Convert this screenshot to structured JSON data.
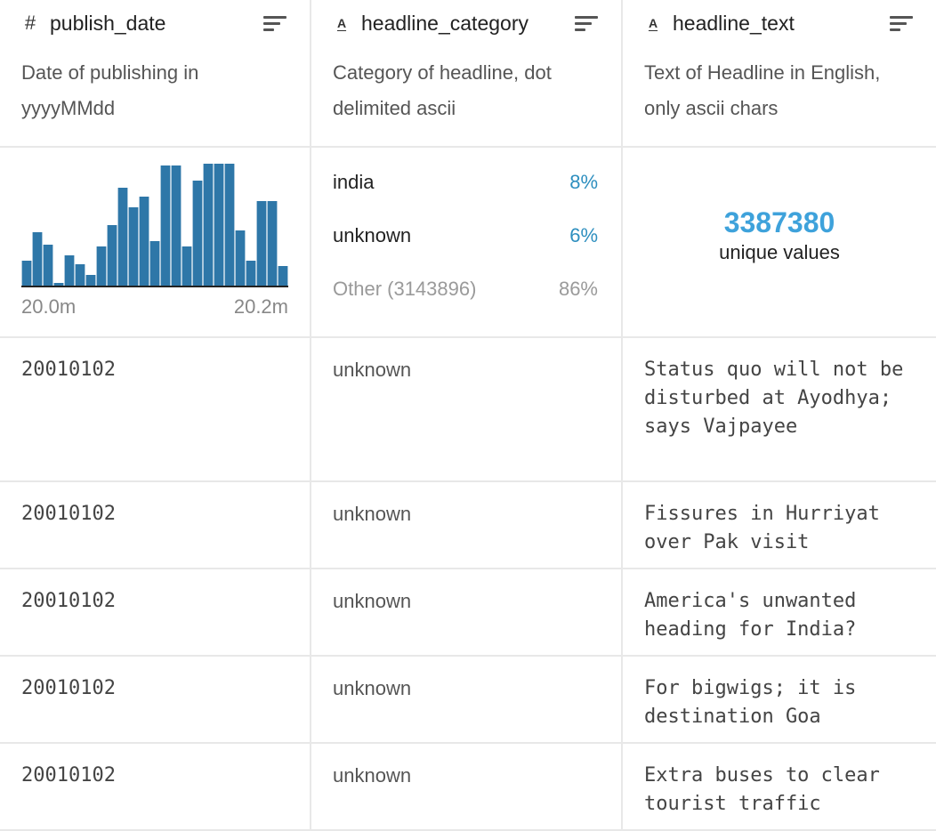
{
  "columns": [
    {
      "type_icon": "#",
      "name": "publish_date",
      "description": "Date of publishing in yyyyMMdd"
    },
    {
      "type_icon": "A",
      "name": "headline_category",
      "description": "Category of headline, dot delimited ascii"
    },
    {
      "type_icon": "A",
      "name": "headline_text",
      "description": "Text of Headline in English, only ascii chars"
    }
  ],
  "chart_data": {
    "type": "bar",
    "values": [
      28,
      60,
      46,
      3,
      34,
      24,
      12,
      44,
      68,
      110,
      88,
      100,
      50,
      135,
      135,
      44,
      118,
      137,
      137,
      137,
      62,
      28,
      95,
      95,
      22
    ],
    "xlabel": "",
    "ylabel": "",
    "tick_labels": [
      "20.0m",
      "20.2m"
    ],
    "color": "#2e77a8"
  },
  "category_stats": [
    {
      "name": "india",
      "pct": "8%"
    },
    {
      "name": "unknown",
      "pct": "6%"
    },
    {
      "name": "Other (3143896)",
      "pct": "86%"
    }
  ],
  "unique": {
    "value": "3387380",
    "label": "unique values"
  },
  "rows": [
    {
      "publish_date": "20010102",
      "headline_category": "unknown",
      "headline_text": "Status quo will not be disturbed at Ayodhya; says Vajpayee"
    },
    {
      "publish_date": "20010102",
      "headline_category": "unknown",
      "headline_text": "Fissures in Hurriyat over Pak visit"
    },
    {
      "publish_date": "20010102",
      "headline_category": "unknown",
      "headline_text": "America's unwanted heading for India?"
    },
    {
      "publish_date": "20010102",
      "headline_category": "unknown",
      "headline_text": "For bigwigs; it is destination Goa"
    },
    {
      "publish_date": "20010102",
      "headline_category": "unknown",
      "headline_text": "Extra buses to clear tourist traffic"
    }
  ]
}
